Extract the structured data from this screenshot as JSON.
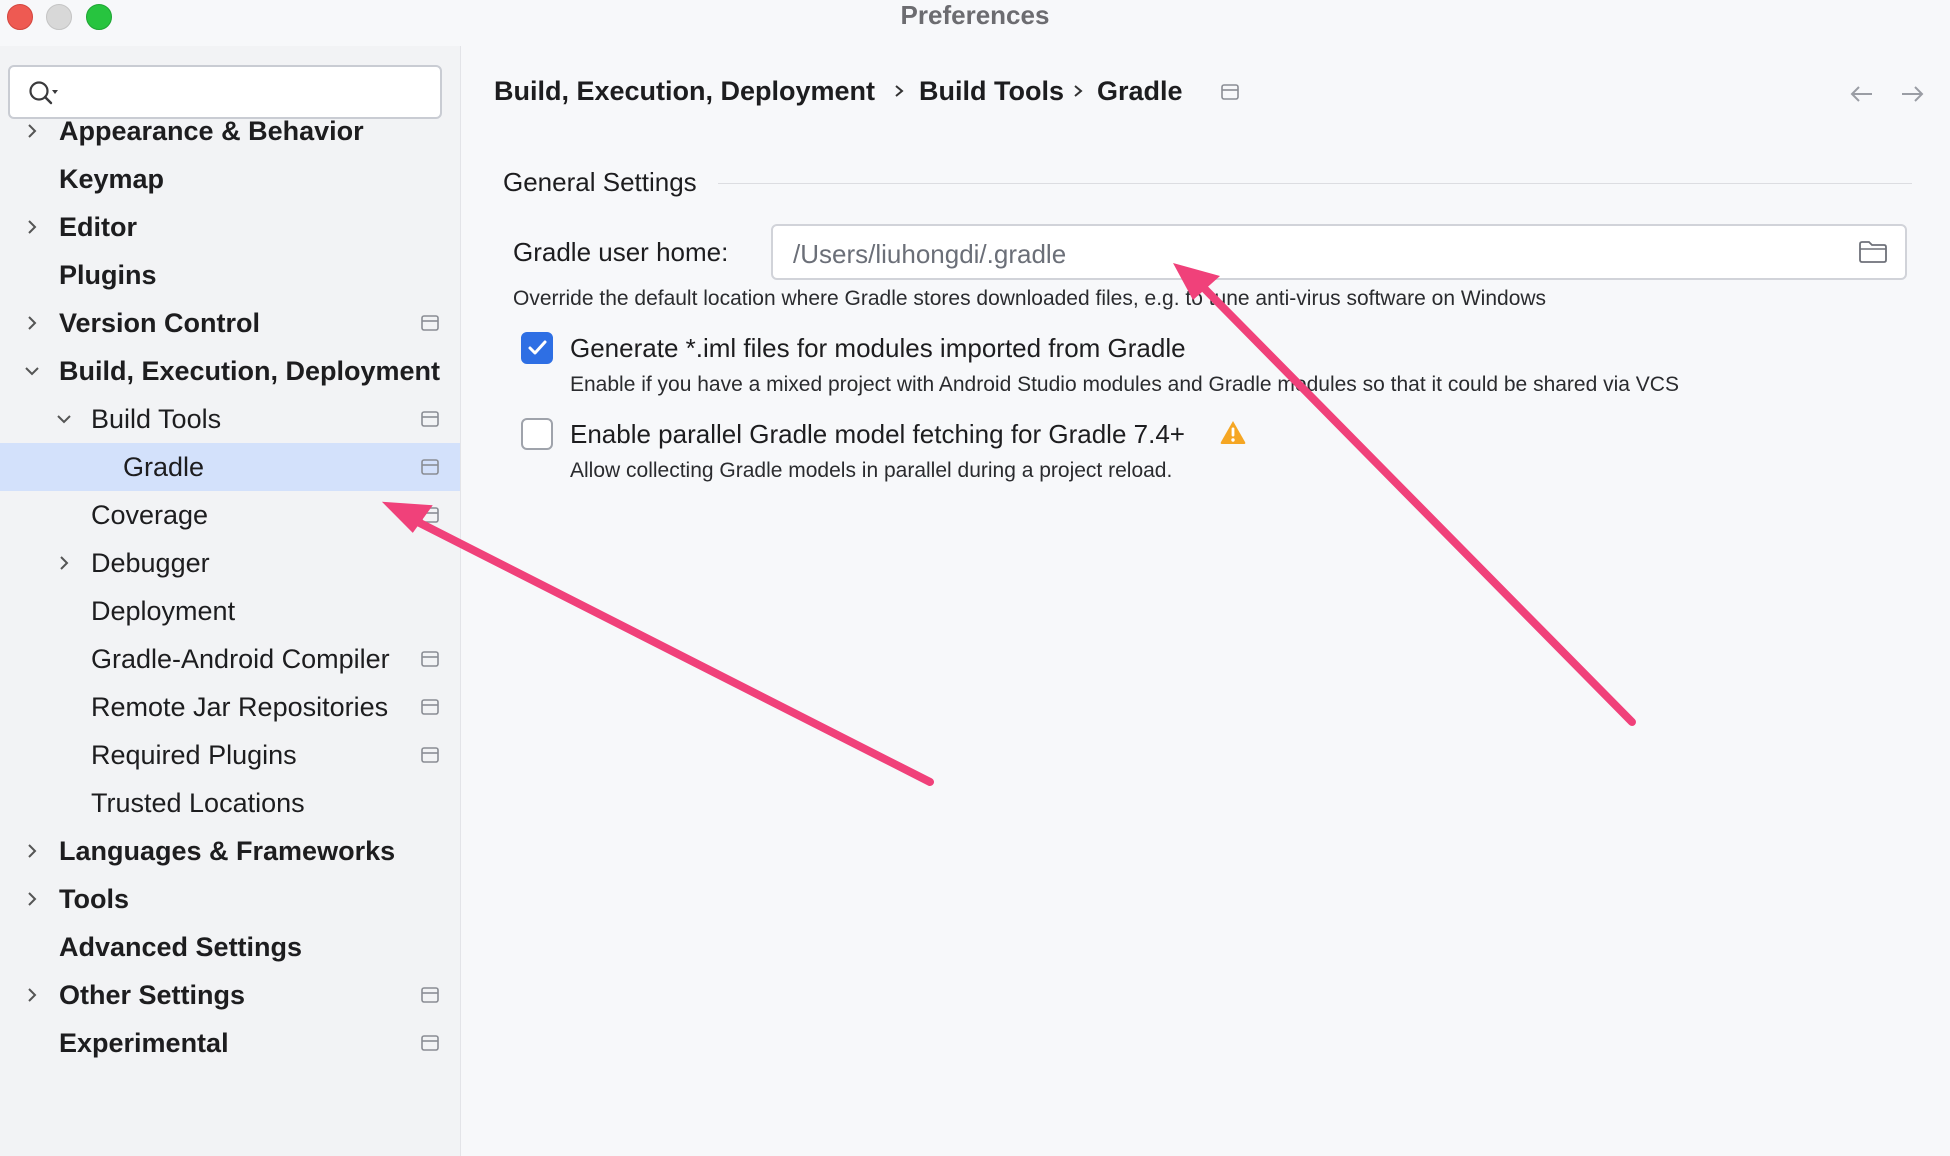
{
  "window": {
    "title": "Preferences"
  },
  "sidebar": {
    "search": {
      "value": "",
      "placeholder": ""
    },
    "items": [
      {
        "label": "Appearance & Behavior",
        "bold": true,
        "chevron": "right"
      },
      {
        "label": "Keymap",
        "bold": true,
        "chevron": "none"
      },
      {
        "label": "Editor",
        "bold": true,
        "chevron": "right"
      },
      {
        "label": "Plugins",
        "bold": true,
        "chevron": "none"
      },
      {
        "label": "Version Control",
        "bold": true,
        "chevron": "right",
        "badge": true
      },
      {
        "label": "Build, Execution, Deployment",
        "bold": true,
        "chevron": "down"
      },
      {
        "label": "Build Tools",
        "bold": false,
        "chevron": "down",
        "badge": true
      },
      {
        "label": "Gradle",
        "bold": false,
        "chevron": "none",
        "badge": true,
        "selected": true
      },
      {
        "label": "Coverage",
        "bold": false,
        "chevron": "none",
        "badge": true
      },
      {
        "label": "Debugger",
        "bold": false,
        "chevron": "right"
      },
      {
        "label": "Deployment",
        "bold": false,
        "chevron": "none"
      },
      {
        "label": "Gradle-Android Compiler",
        "bold": false,
        "chevron": "none",
        "badge": true
      },
      {
        "label": "Remote Jar Repositories",
        "bold": false,
        "chevron": "none",
        "badge": true
      },
      {
        "label": "Required Plugins",
        "bold": false,
        "chevron": "none",
        "badge": true
      },
      {
        "label": "Trusted Locations",
        "bold": false,
        "chevron": "none"
      },
      {
        "label": "Languages & Frameworks",
        "bold": true,
        "chevron": "right"
      },
      {
        "label": "Tools",
        "bold": true,
        "chevron": "right"
      },
      {
        "label": "Advanced Settings",
        "bold": true,
        "chevron": "none"
      },
      {
        "label": "Other Settings",
        "bold": true,
        "chevron": "right",
        "badge": true
      },
      {
        "label": "Experimental",
        "bold": true,
        "chevron": "none",
        "badge": true
      }
    ]
  },
  "header": {
    "breadcrumb": [
      "Build, Execution, Deployment",
      "Build Tools",
      "Gradle"
    ]
  },
  "settings": {
    "section_title": "General Settings",
    "gradle_home": {
      "label": "Gradle user home:",
      "value": "/Users/liuhongdi/.gradle",
      "hint": "Override the default location where Gradle stores downloaded files, e.g. to tune anti-virus software on Windows"
    },
    "generate_iml": {
      "checked": true,
      "label": "Generate *.iml files for modules imported from Gradle",
      "hint": "Enable if you have a mixed project with Android Studio modules and Gradle modules so that it could be shared via VCS"
    },
    "parallel_fetch": {
      "checked": false,
      "label": "Enable parallel Gradle model fetching for Gradle 7.4+",
      "hint": "Allow collecting Gradle models in parallel during a project reload."
    }
  },
  "colors": {
    "accent": "#2e6fe4",
    "selection": "#d3e1fb",
    "annotation_arrow": "#f0417a",
    "warning": "#f5a623"
  }
}
